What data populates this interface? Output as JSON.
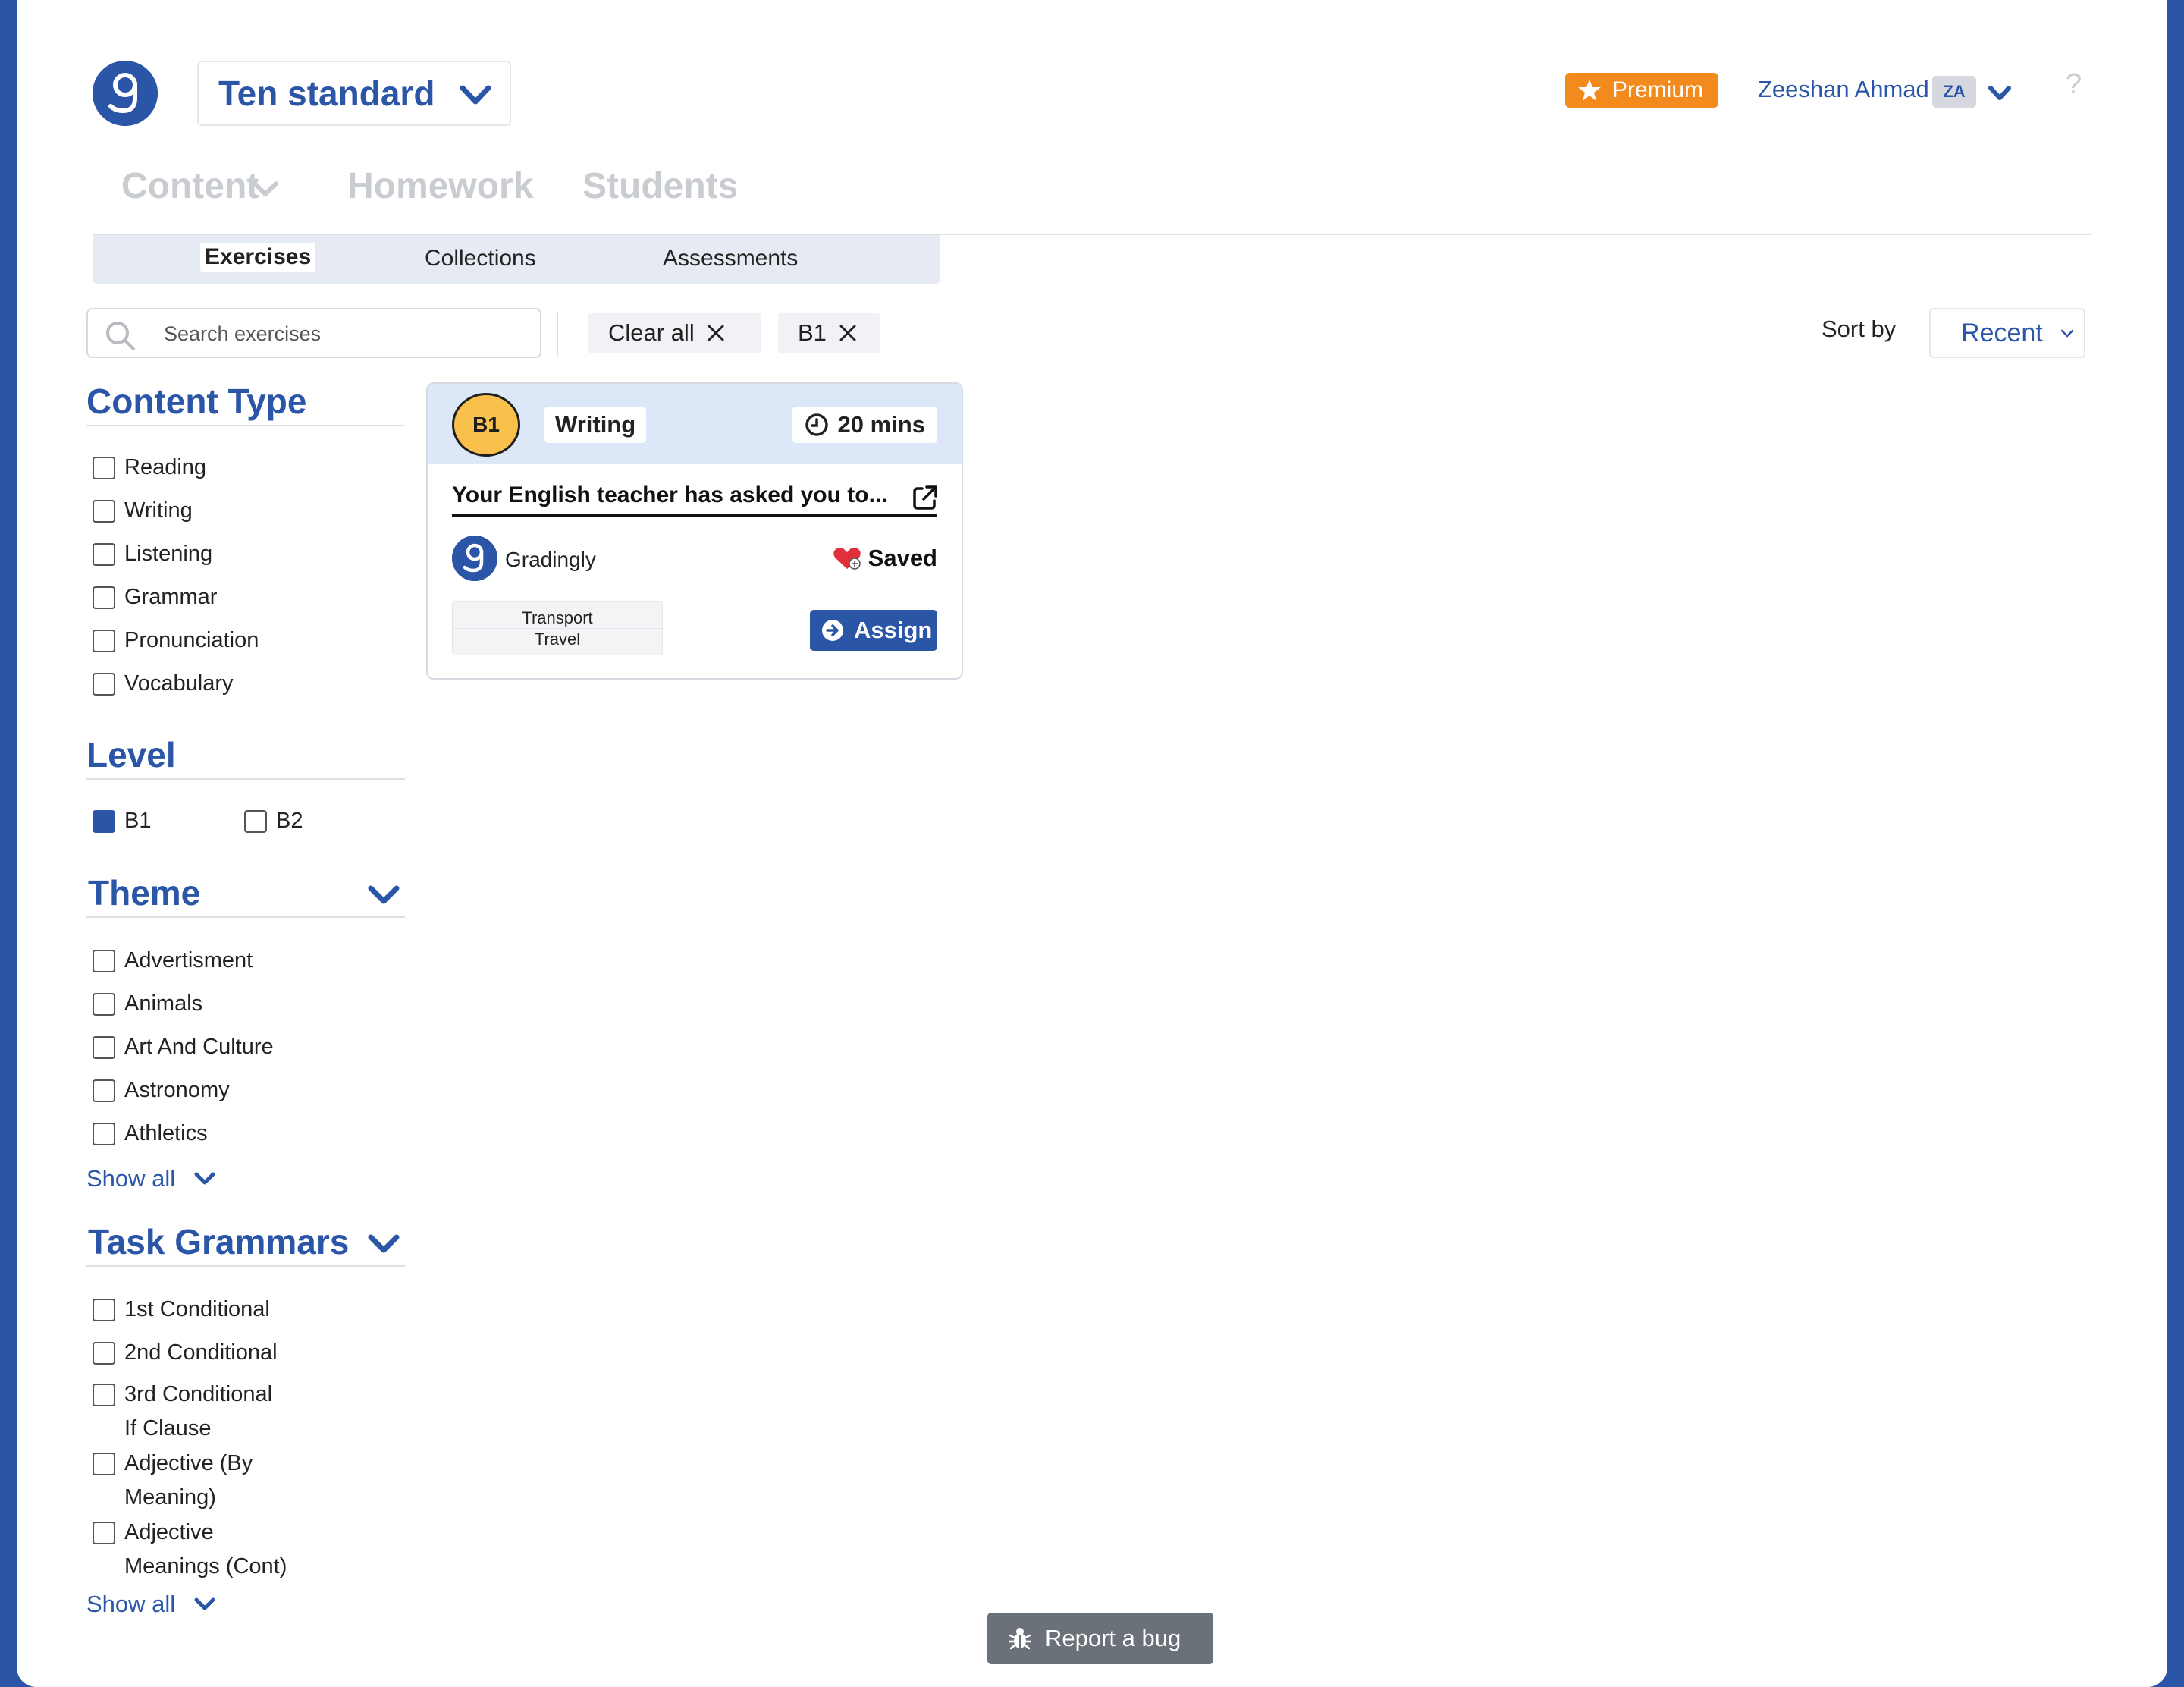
{
  "header": {
    "class_name": "Ten standard",
    "premium_label": "Premium",
    "user_name": "Zeeshan Ahmad",
    "user_initials": "ZA",
    "help_label": "?"
  },
  "nav": {
    "items": [
      "Content",
      "Homework",
      "Students"
    ]
  },
  "subtabs": [
    "Exercises",
    "Collections",
    "Assessments"
  ],
  "search": {
    "placeholder": "Search exercises"
  },
  "chips": {
    "clear_all": "Clear all",
    "level": "B1"
  },
  "sort": {
    "label": "Sort by",
    "value": "Recent"
  },
  "sidebar": {
    "content_type": {
      "title": "Content Type",
      "items": [
        "Reading",
        "Writing",
        "Listening",
        "Grammar",
        "Pronunciation",
        "Vocabulary"
      ]
    },
    "level": {
      "title": "Level",
      "items": [
        {
          "label": "B1",
          "checked": true
        },
        {
          "label": "B2",
          "checked": false
        }
      ]
    },
    "theme": {
      "title": "Theme",
      "items": [
        "Advertisment",
        "Animals",
        "Art And Culture",
        "Astronomy",
        "Athletics"
      ],
      "show_all": "Show all"
    },
    "task_grammars": {
      "title": "Task Grammars",
      "items": [
        "1st Conditional",
        "2nd Conditional",
        "3rd Conditional\nIf Clause",
        "Adjective (By\nMeaning)",
        "Adjective\nMeanings (Cont)"
      ],
      "show_all": "Show all"
    }
  },
  "card": {
    "level": "B1",
    "type": "Writing",
    "duration": "20 mins",
    "title": "Your English teacher has asked you to...",
    "author": "Gradingly",
    "saved_label": "Saved",
    "tags": [
      "Transport",
      "Travel"
    ],
    "assign_label": "Assign"
  },
  "footer": {
    "report_bug": "Report a bug"
  },
  "colors": {
    "brand": "#2b56a7",
    "premium": "#f28a1e",
    "level_badge": "#f9c04c",
    "saved_heart": "#e0303c"
  }
}
